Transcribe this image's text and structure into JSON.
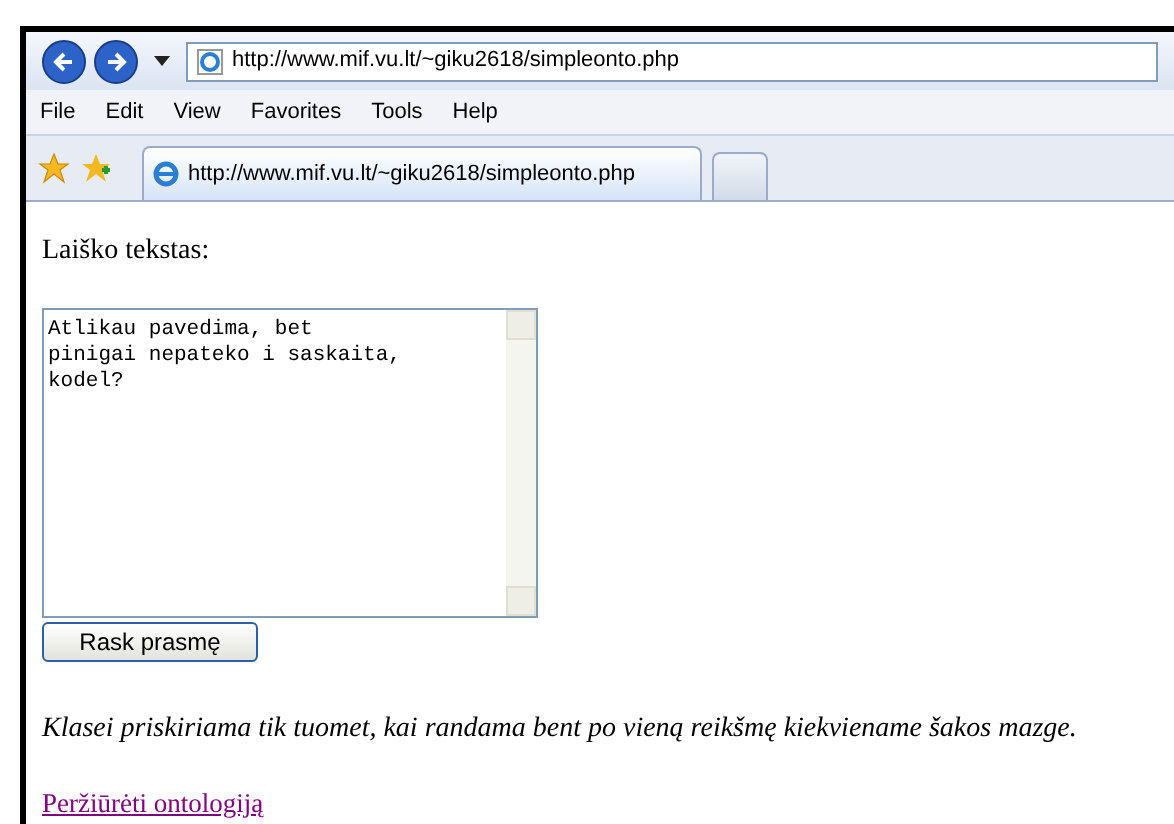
{
  "address_bar": {
    "url": "http://www.mif.vu.lt/~giku2618/simpleonto.php"
  },
  "menu": [
    "File",
    "Edit",
    "View",
    "Favorites",
    "Tools",
    "Help"
  ],
  "tabs": [
    {
      "label": "http://www.mif.vu.lt/~giku2618/simpleonto.php",
      "selected": true
    }
  ],
  "page": {
    "label": "Laiško tekstas:",
    "textarea": {
      "value": "Atlikau pavedima, bet\npinigai nepateko i saskaita,\nkodel?"
    },
    "button": "Rask prasmę",
    "note": "Klasei priskiriama tik tuomet, kai randama bent po vieną reikšmę kiekviename šakos mazge.",
    "link": "Peržiūrėti ontologiją"
  }
}
